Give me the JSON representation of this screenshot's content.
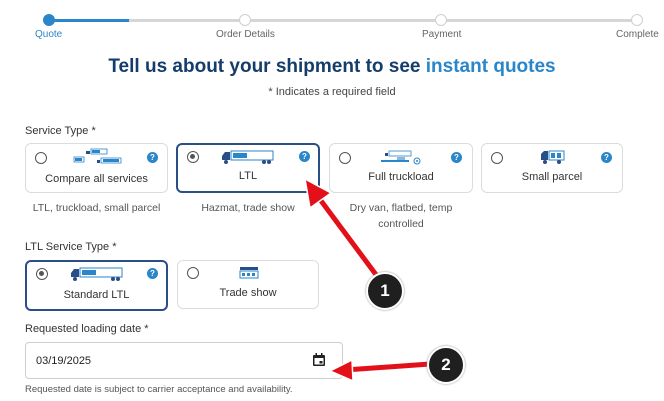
{
  "progress": {
    "steps": [
      {
        "label": "Quote"
      },
      {
        "label": "Order Details"
      },
      {
        "label": "Payment"
      },
      {
        "label": "Complete"
      }
    ],
    "active_color": "#2a86c9"
  },
  "heading": {
    "main": "Tell us about your shipment to see",
    "highlight": "instant quotes",
    "required_note": "* Indicates a required field"
  },
  "service_type": {
    "label": "Service Type *",
    "options": [
      {
        "label": "Compare all services",
        "subtext": "LTL, truckload, small parcel",
        "selected": false,
        "icon": "multi-truck-icon"
      },
      {
        "label": "LTL",
        "subtext": "Hazmat, trade show",
        "selected": true,
        "icon": "ltl-truck-icon"
      },
      {
        "label": "Full truckload",
        "subtext_line1": "Dry van, flatbed, temp",
        "subtext_line2": "controlled",
        "selected": false,
        "icon": "full-truckload-icon"
      },
      {
        "label": "Small parcel",
        "selected": false,
        "icon": "parcel-van-icon"
      }
    ]
  },
  "ltl_service_type": {
    "label": "LTL Service Type *",
    "options": [
      {
        "label": "Standard LTL",
        "selected": true,
        "icon": "standard-ltl-truck-icon"
      },
      {
        "label": "Trade show",
        "selected": false,
        "icon": "trade-show-icon"
      }
    ]
  },
  "loading_date": {
    "label": "Requested loading date *",
    "value": "03/19/2025",
    "note": "Requested date is subject to carrier acceptance and availability."
  },
  "annotations": [
    {
      "number": "1"
    },
    {
      "number": "2"
    }
  ],
  "colors": {
    "brand_dark": "#153d6b",
    "accent": "#2a86c9",
    "arrow": "#e3101a"
  }
}
